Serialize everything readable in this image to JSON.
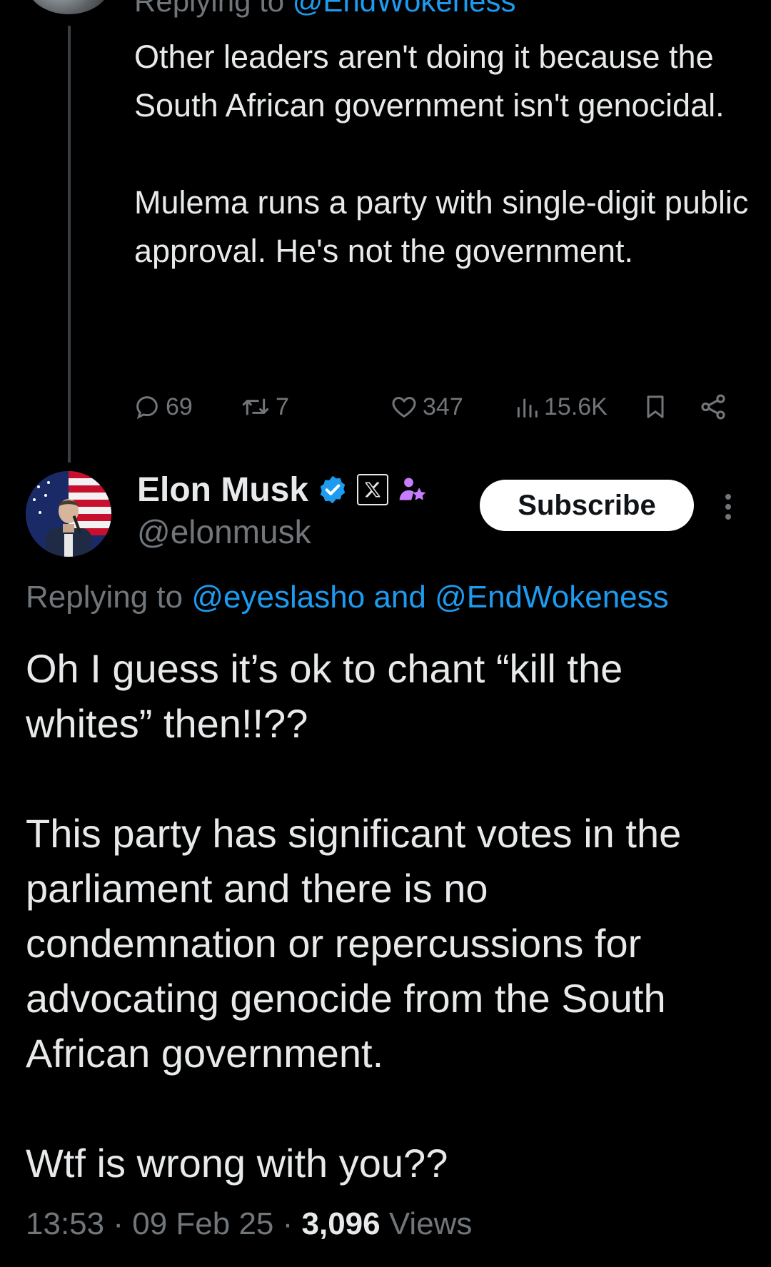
{
  "previous_tweet": {
    "replying_to_prefix": "Replying to",
    "replying_to_handle": "@EndWokeness",
    "paragraphs": [
      "Other leaders aren't doing it because the South African government isn't genocidal.",
      "Mulema runs a party with single-digit public approval. He's not the government."
    ],
    "actions": {
      "replies": "69",
      "reposts": "7",
      "likes": "347",
      "views": "15.6K"
    }
  },
  "tweet": {
    "author": {
      "display_name": "Elon Musk",
      "handle": "@elonmusk"
    },
    "subscribe_label": "Subscribe",
    "replying_to_prefix": "Replying to",
    "replying_to_handle_1": "@eyeslasho",
    "replying_to_and": "and",
    "replying_to_handle_2": "@EndWokeness",
    "paragraphs": [
      "Oh I guess it’s ok to chant “kill the whites” then!!??",
      "This party has significant votes in the parliament and there is no condemnation or repercussions for advocating genocide from the South African government.",
      "Wtf is wrong with you??"
    ],
    "time": "13:53",
    "date": "09 Feb 25",
    "separator": "·",
    "views_count": "3,096",
    "views_label": "Views"
  },
  "icons": {
    "reply": "reply-icon",
    "repost": "repost-icon",
    "like": "heart-icon",
    "views": "bar-chart-icon",
    "bookmark": "bookmark-icon",
    "share": "share-icon",
    "verified": "verified-badge-icon",
    "x_logo": "x-logo-icon",
    "affiliate": "affiliate-icon",
    "more": "more-options-icon"
  },
  "colors": {
    "background": "#000000",
    "text": "#e7e9ea",
    "secondary": "#71767b",
    "link": "#1d9bf0",
    "verified": "#1d9bf0",
    "affiliate": "#c77dff"
  }
}
